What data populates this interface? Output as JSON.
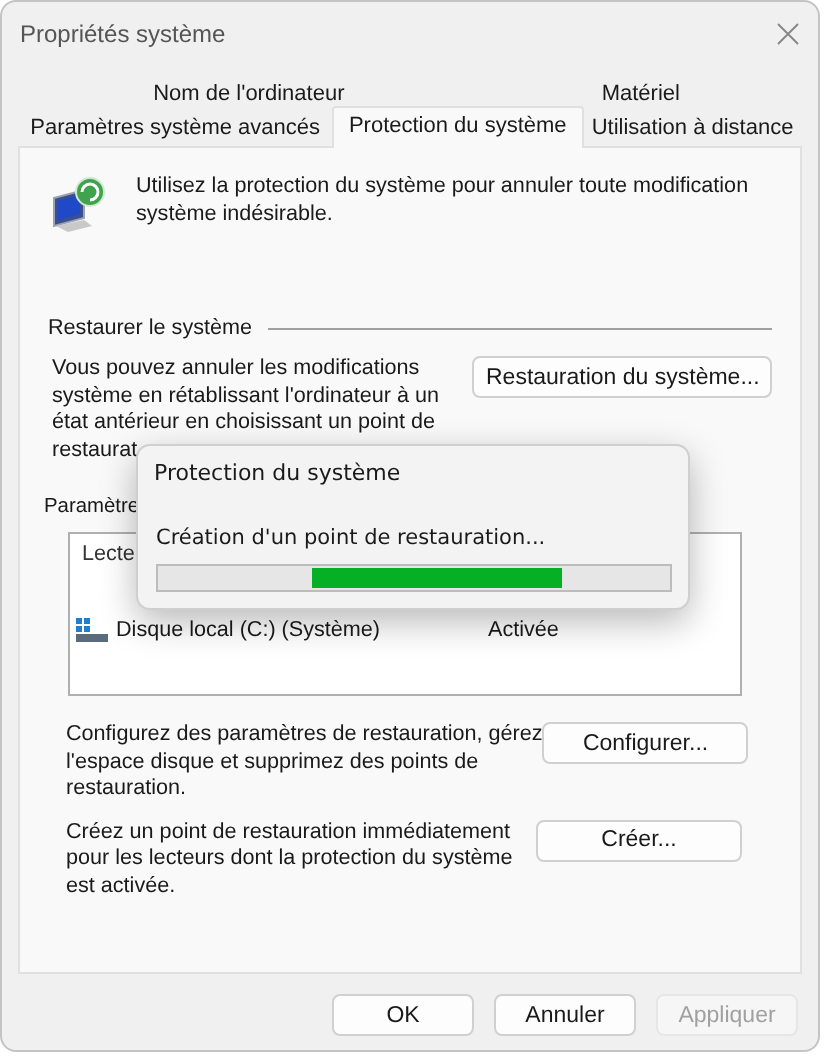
{
  "window": {
    "title": "Propriétés système"
  },
  "tabs": [
    [
      {
        "label": "Nom de l'ordinateur",
        "selected": false
      },
      {
        "label": "Matériel",
        "selected": false
      }
    ],
    [
      {
        "label": "Paramètres système avancés",
        "selected": false
      },
      {
        "label": "Protection du système",
        "selected": true
      },
      {
        "label": "Utilisation à distance",
        "selected": false
      }
    ]
  ],
  "intro": [
    "Utilisez la protection du système pour annuler toute modification",
    "système indésirable."
  ],
  "restore": {
    "heading": "Restaurer le système",
    "text": [
      "Vous pouvez annuler les modifications",
      "système en rétablissant l'ordinateur à un",
      "état antérieur en choisissant un point de",
      "restaurat"
    ],
    "button": "Restauration du système..."
  },
  "protection": {
    "heading": "Paramètre",
    "columns": [
      "Lecte"
    ],
    "rows": [
      {
        "drive": "Disque local (C:) (Système)",
        "status": "Activée",
        "selected": false
      }
    ],
    "actions": [
      {
        "text": [
          "Configurez des paramètres de restauration, gérez",
          "l'espace disque et supprimez des points de",
          "restauration."
        ],
        "button": "Configurer..."
      },
      {
        "text": [
          "Créez un point de restauration immédiatement",
          "pour les lecteurs dont la protection du système",
          "est activée."
        ],
        "button": "Créer..."
      }
    ]
  },
  "buttons": [
    {
      "label": "OK",
      "disabled": false
    },
    {
      "label": "Annuler",
      "disabled": false
    },
    {
      "label": "Appliquer",
      "disabled": true
    }
  ],
  "progress_dialog": {
    "title": "Protection du système",
    "message": "Création d'un point de restauration...",
    "progress": {
      "kind": "marquee",
      "level": 0.49
    }
  }
}
